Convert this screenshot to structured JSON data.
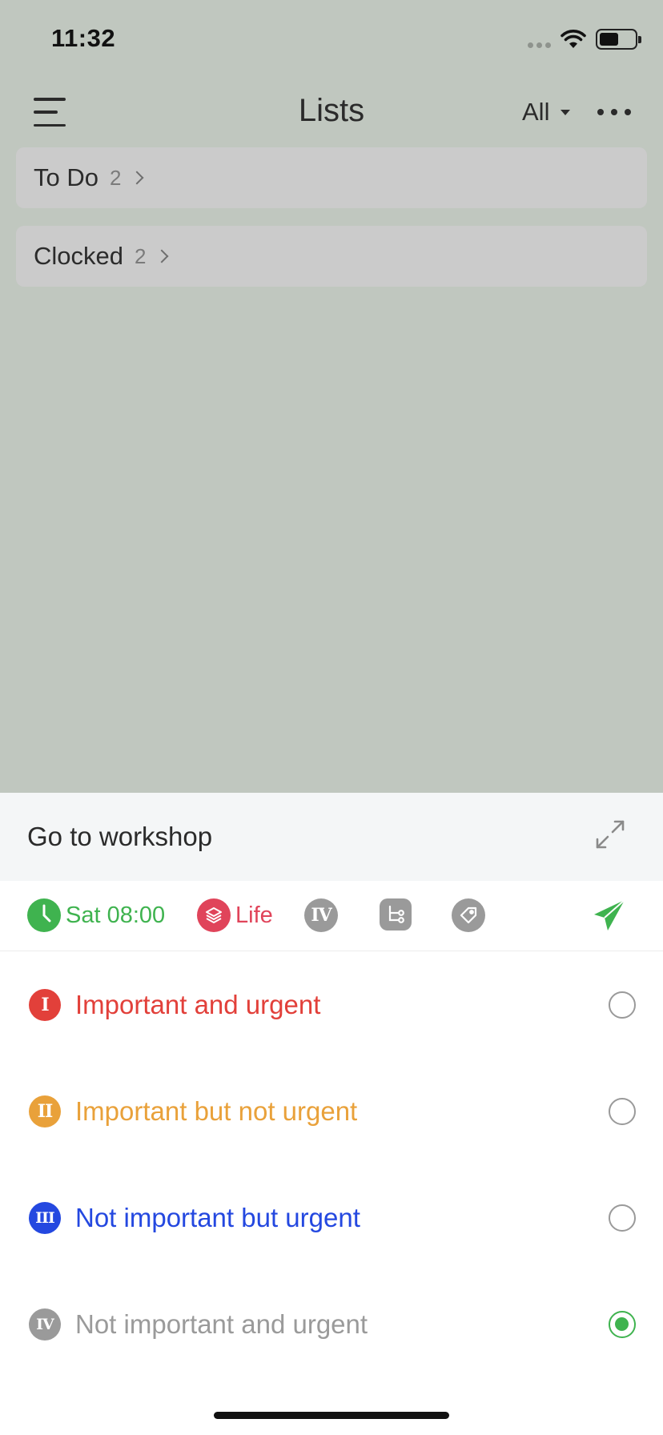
{
  "status_bar": {
    "time": "11:32",
    "battery_level": 0.55
  },
  "nav": {
    "title": "Lists",
    "filter_label": "All"
  },
  "lists": [
    {
      "name": "To Do",
      "count": "2"
    },
    {
      "name": "Clocked",
      "count": "2"
    }
  ],
  "task": {
    "title": "Go to workshop",
    "schedule": "Sat 08:00",
    "list_label": "Life",
    "priority_marker": "IV"
  },
  "priorities": [
    {
      "roman": "I",
      "label": "Important and urgent",
      "color": "#e2403a",
      "selected": false
    },
    {
      "roman": "II",
      "label": "Important but not urgent",
      "color": "#e9a13a",
      "selected": false
    },
    {
      "roman": "III",
      "label": "Not important but urgent",
      "color": "#2448e0",
      "selected": false
    },
    {
      "roman": "IV",
      "label": "Not important and urgent",
      "color": "#9a9a9a",
      "selected": true
    }
  ],
  "colors": {
    "background": "#c0c7bf",
    "accent_green": "#3fb34f",
    "life_red": "#e0445a",
    "icon_gray": "#9a9a9a"
  },
  "icons": {
    "clock": "clock-icon",
    "list": "layers-icon",
    "subtask": "subtask-icon",
    "tag": "tag-icon",
    "send": "paper-plane-icon",
    "expand": "expand-icon"
  }
}
